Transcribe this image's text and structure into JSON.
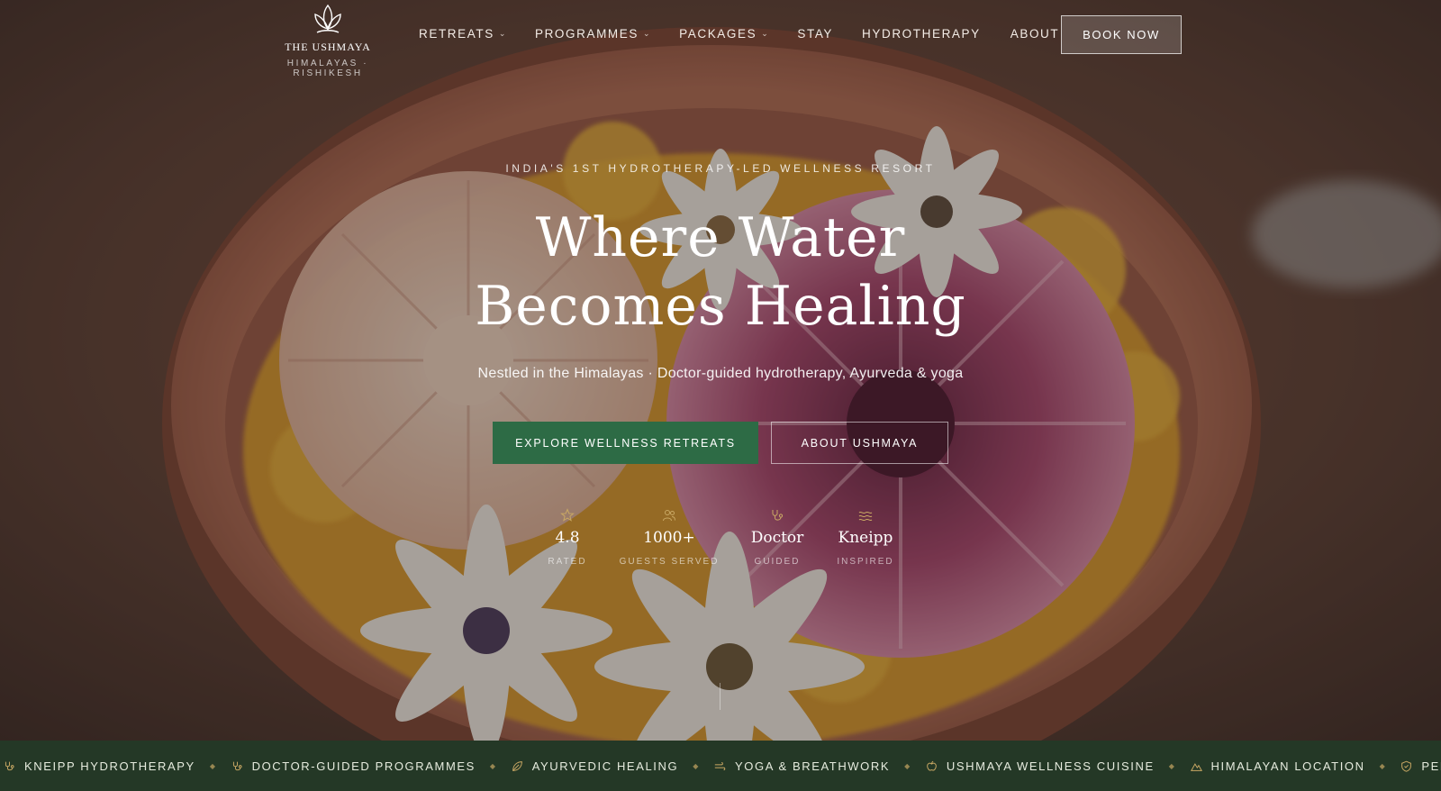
{
  "brand": {
    "name": "THE USHMAYA",
    "tagline": "HIMALAYAS · RISHIKESH"
  },
  "nav": {
    "items": [
      {
        "label": "RETREATS",
        "has_dropdown": true
      },
      {
        "label": "PROGRAMMES",
        "has_dropdown": true
      },
      {
        "label": "PACKAGES",
        "has_dropdown": true
      },
      {
        "label": "STAY",
        "has_dropdown": false
      },
      {
        "label": "HYDROTHERAPY",
        "has_dropdown": false
      },
      {
        "label": "ABOUT",
        "has_dropdown": false
      }
    ],
    "dropdown_glyph": "⌄",
    "cta": "BOOK NOW"
  },
  "hero": {
    "eyebrow": "INDIA'S 1ST HYDROTHERAPY-LED WELLNESS RESORT",
    "headline_line1": "Where Water",
    "headline_line2": "Becomes Healing",
    "subtitle": "Nestled in the Himalayas · Doctor-guided hydrotherapy, Ayurveda & yoga",
    "primary_button": "EXPLORE WELLNESS RETREATS",
    "secondary_button": "ABOUT USHMAYA"
  },
  "stats": [
    {
      "icon": "star-icon",
      "value": "4.8",
      "label": "RATED"
    },
    {
      "icon": "users-icon",
      "value": "1000+",
      "label": "GUESTS SERVED"
    },
    {
      "icon": "stethoscope-icon",
      "value": "Doctor",
      "label": "GUIDED"
    },
    {
      "icon": "waves-icon",
      "value": "Kneipp",
      "label": "INSPIRED"
    }
  ],
  "ticker": {
    "items": [
      {
        "icon": "stethoscope-icon",
        "label": "KNEIPP HYDROTHERAPY"
      },
      {
        "icon": "stethoscope-icon",
        "label": "DOCTOR-GUIDED PROGRAMMES"
      },
      {
        "icon": "leaf-icon",
        "label": "AYURVEDIC HEALING"
      },
      {
        "icon": "wind-icon",
        "label": "YOGA & BREATHWORK"
      },
      {
        "icon": "apple-icon",
        "label": "USHMAYA WELLNESS CUISINE"
      },
      {
        "icon": "mountain-icon",
        "label": "HIMALAYAN LOCATION"
      },
      {
        "icon": "shield-icon",
        "label": "PERSONALISED"
      }
    ],
    "separator": "◆"
  },
  "colors": {
    "accent_green": "#2d6b45",
    "ticker_bg": "#243826",
    "ticker_icon": "#c9a864"
  }
}
